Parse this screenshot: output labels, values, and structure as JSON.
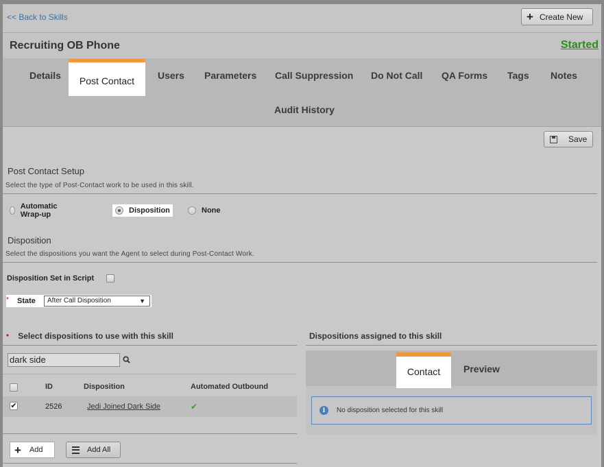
{
  "header": {
    "back_link": "<< Back to Skills",
    "create_label": "Create New",
    "title": "Recruiting OB Phone",
    "status": "Started"
  },
  "tabs": [
    {
      "label": "Details",
      "active": false
    },
    {
      "label": "Post Contact",
      "active": true
    },
    {
      "label": "Users",
      "active": false
    },
    {
      "label": "Parameters",
      "active": false
    },
    {
      "label": "Call Suppression",
      "active": false
    },
    {
      "label": "Do Not Call",
      "active": false
    },
    {
      "label": "QA Forms",
      "active": false
    },
    {
      "label": "Tags",
      "active": false
    },
    {
      "label": "Notes",
      "active": false
    },
    {
      "label": "Audit History",
      "active": false
    }
  ],
  "toolbar": {
    "save_label": "Save"
  },
  "post_contact": {
    "heading": "Post Contact Setup",
    "description": "Select the type of Post-Contact work to be used in this skill.",
    "options": [
      {
        "label": "Automatic Wrap-up",
        "selected": false
      },
      {
        "label": "Disposition",
        "selected": true
      },
      {
        "label": "None",
        "selected": false
      }
    ]
  },
  "disposition": {
    "heading": "Disposition",
    "description": "Select the dispositions you want the Agent to select during Post-Contact Work.",
    "set_in_script_label": "Disposition Set in Script",
    "set_in_script_checked": false,
    "state_required_mark": "*",
    "state_label": "State",
    "state_value": "After Call Disposition"
  },
  "select_panel": {
    "required_mark": "*",
    "heading": "Select dispositions to use with this skill",
    "search_value": "dark side",
    "columns": [
      "ID",
      "Disposition",
      "Automated Outbound"
    ],
    "rows": [
      {
        "checked": true,
        "id": "2526",
        "disposition": "Jedi Joined Dark Side",
        "automated_outbound": true
      }
    ],
    "add_label": "Add",
    "add_all_label": "Add All"
  },
  "assigned_panel": {
    "heading": "Dispositions assigned to this skill",
    "tabs": [
      {
        "label": "Contact",
        "active": true
      },
      {
        "label": "Preview",
        "active": false
      }
    ],
    "empty_message": "No disposition selected for this skill"
  },
  "colors": {
    "accent": "#f6963b",
    "status_green": "#2e8b1f",
    "link_blue": "#3b6fa0",
    "info_blue": "#4a7fbf"
  }
}
